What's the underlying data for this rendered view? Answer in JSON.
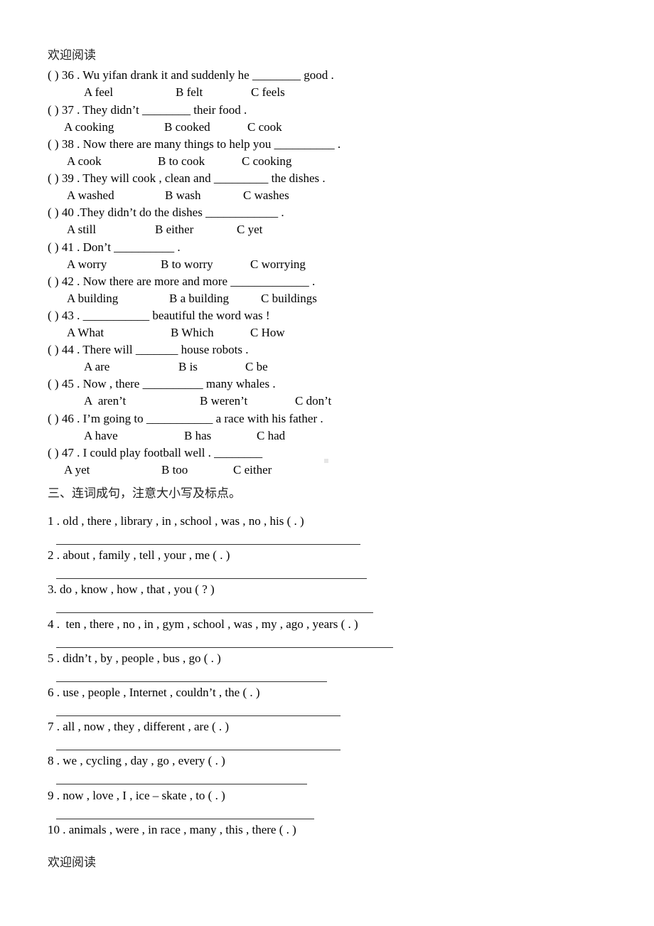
{
  "header": "欢迎阅读",
  "footer": "欢迎阅读",
  "mc_questions": [
    {
      "q": "( ) 36 . Wu yifan drank it and suddenly he ________ good .",
      "a": "A feel",
      "b": "B felt",
      "c": "C feels"
    },
    {
      "q": "( ) 37 . They didn’t ________ their food .",
      "a": "A cooking",
      "b": "B cooked",
      "c": "C cook"
    },
    {
      "q": "( ) 38 . Now there are many things to help you __________ .",
      "a": "A cook",
      "b": "B to cook",
      "c": "C cooking"
    },
    {
      "q": "( ) 39 . They will cook , clean and _________ the dishes .",
      "a": "A washed",
      "b": "B wash",
      "c": "C washes"
    },
    {
      "q": "( ) 40 .They didn’t do the dishes ____________ .",
      "a": "A still",
      "b": "B either",
      "c": "C yet"
    },
    {
      "q": "( ) 41 . Don’t __________ .",
      "a": "A worry",
      "b": "B to worry",
      "c": "C worrying"
    },
    {
      "q": "( ) 42 . Now there are more and more _____________ .",
      "a": "A building",
      "b": "B a building",
      "c": "C buildings"
    },
    {
      "q": "( ) 43 . ___________ beautiful the word was !",
      "a": "A What",
      "b": "B Which",
      "c": "C How"
    },
    {
      "q": "( ) 44 . There will _______ house robots .",
      "a": "A are",
      "b": "B is",
      "c": "C be"
    },
    {
      "q": "( ) 45 . Now , there __________ many whales .",
      "a": "A  aren’t",
      "b": "B weren’t",
      "c": "C don’t"
    },
    {
      "q": "( ) 46 . I’m going to ___________ a race with his father .",
      "a": "A have",
      "b": "B has",
      "c": "C had"
    },
    {
      "q": "( ) 47 . I could play football well . ________",
      "a": "A yet",
      "b": "B too",
      "c": "C either"
    }
  ],
  "section3": {
    "title": "三、连词成句，注意大小写及标点。",
    "items": [
      "1 . old , there , library , in , school , was , no , his ( . )",
      "2 . about , family , tell , your , me ( . )",
      "3. do , know , how , that , you ( ? )",
      "4 .  ten , there , no , in , gym , school , was , my , ago , years ( . )",
      "5 . didn’t , by , people , bus , go ( . )",
      "6 . use , people , Internet , couldn’t , the ( . )",
      "7 . all , now , they , different , are ( . )",
      "8 . we , cycling , day , go , every ( . )",
      "9 . now , love , I , ice – skate , to ( . )",
      "10 . animals , were , in race , many , this , there ( . )"
    ]
  }
}
